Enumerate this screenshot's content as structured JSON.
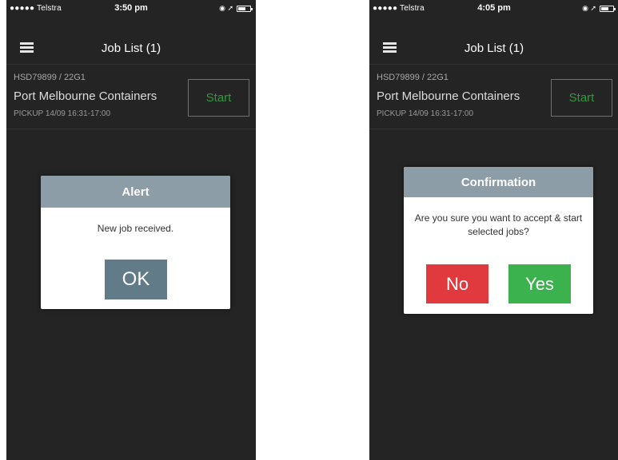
{
  "screens": [
    {
      "status": {
        "carrier": "●●●●● Telstra",
        "time": "3:50 pm",
        "icons": "◉ ➚"
      },
      "nav": {
        "title": "Job List (1)"
      },
      "job": {
        "code": "HSD79899 / 22G1",
        "name": "Port Melbourne Containers",
        "pickup": "PICKUP  14/09 16:31-17:00",
        "start_label": "Start"
      },
      "dialog": {
        "title": "Alert",
        "message": "New job received.",
        "ok_label": "OK"
      }
    },
    {
      "status": {
        "carrier": "●●●●● Telstra",
        "time": "4:05 pm",
        "icons": "◉ ➚"
      },
      "nav": {
        "title": "Job List (1)"
      },
      "job": {
        "code": "HSD79899 / 22G1",
        "name": "Port Melbourne Containers",
        "pickup": "PICKUP  14/09 16:31-17:00",
        "start_label": "Start"
      },
      "dialog": {
        "title": "Confirmation",
        "message": "Are you sure you want to accept & start selected jobs?",
        "no_label": "No",
        "yes_label": "Yes"
      }
    }
  ],
  "colors": {
    "background": "#242424",
    "dialog_header": "#8d9da7",
    "ok_button": "#617b88",
    "start_border": "#2e9a3e",
    "no_button": "#e0393e",
    "yes_button": "#3cb24f"
  },
  "icons": {
    "menu": "hamburger-menu-icon",
    "wifi": "wifi-icon",
    "location": "location-arrow-icon",
    "battery": "battery-icon"
  }
}
